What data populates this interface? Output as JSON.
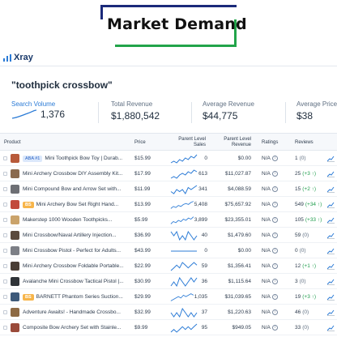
{
  "banner": {
    "title": "Market Demand"
  },
  "app": {
    "name": "Xray"
  },
  "query": "\"toothpick crossbow\"",
  "stats": {
    "search_volume": {
      "label": "Search Volume",
      "value": "1,376"
    },
    "total_revenue": {
      "label": "Total Revenue",
      "value": "$1,880,542"
    },
    "average_revenue": {
      "label": "Average Revenue",
      "value": "$44,775"
    },
    "average_price": {
      "label": "Average Price",
      "value": "$38"
    }
  },
  "table": {
    "columns": {
      "product": "Product",
      "price": "Price",
      "sales_1": "Parent Level",
      "sales_2": "Sales",
      "revenue_1": "Parent Level",
      "revenue_2": "Revenue",
      "ratings": "Ratings",
      "reviews": "Reviews"
    },
    "rows": [
      {
        "badge": "ABA #1",
        "badge_type": "aba",
        "name": "Mini Toothpick Bow Toy | Durab...",
        "price": "$15.99",
        "sales": "0",
        "revenue": "$0.00",
        "ratings": "N/A",
        "reviews": "1",
        "reviews_paren": "(0)",
        "reviews_delta": "",
        "thumb": "#b85a3a",
        "spark": [
          2,
          3,
          2,
          4,
          3,
          5,
          4,
          6,
          5,
          7
        ]
      },
      {
        "badge": "",
        "badge_type": "",
        "name": "Mini Archery Crossbow DIY Assembly Kit...",
        "price": "$17.99",
        "sales": "613",
        "revenue": "$11,027.87",
        "ratings": "N/A",
        "reviews": "25",
        "reviews_paren": "(+3 ↑)",
        "reviews_delta": "",
        "thumb": "#8a6a4e",
        "spark": [
          3,
          4,
          3,
          5,
          6,
          5,
          7,
          6,
          8,
          7
        ]
      },
      {
        "badge": "",
        "badge_type": "",
        "name": "Mini Compound Bow and Arrow Set with...",
        "price": "$11.99",
        "sales": "341",
        "revenue": "$4,088.59",
        "ratings": "N/A",
        "reviews": "15",
        "reviews_paren": "(+2 ↑)",
        "reviews_delta": "",
        "thumb": "#6d6f74",
        "spark": [
          4,
          3,
          5,
          4,
          5,
          3,
          6,
          5,
          6,
          7
        ]
      },
      {
        "badge": "BS",
        "badge_type": "bs",
        "name": "Mini Archery Bow Set Right Hand...",
        "price": "$13.99",
        "sales": "5,408",
        "revenue": "$75,657.92",
        "ratings": "N/A",
        "reviews": "549",
        "reviews_paren": "(+34 ↑)",
        "reviews_delta": "",
        "thumb": "#c24a3c",
        "spark": [
          2,
          4,
          3,
          5,
          4,
          6,
          7,
          6,
          8,
          9
        ]
      },
      {
        "badge": "",
        "badge_type": "",
        "name": "Makerstep 1000 Wooden Toothpicks...",
        "price": "$5.99",
        "sales": "3,899",
        "revenue": "$23,355.01",
        "ratings": "N/A",
        "reviews": "105",
        "reviews_paren": "(+33 ↑)",
        "reviews_delta": "",
        "thumb": "#caa36b",
        "spark": [
          3,
          5,
          4,
          6,
          5,
          7,
          6,
          8,
          7,
          9
        ]
      },
      {
        "badge": "",
        "badge_type": "",
        "name": "Mini Crossbow/Naval Artillery Injection...",
        "price": "$36.99",
        "sales": "40",
        "revenue": "$1,479.60",
        "ratings": "N/A",
        "reviews": "59",
        "reviews_paren": "(0)",
        "reviews_delta": "",
        "thumb": "#5a4a3e",
        "spark": [
          5,
          4,
          5,
          3,
          4,
          3,
          5,
          4,
          3,
          4
        ]
      },
      {
        "badge": "",
        "badge_type": "",
        "name": "Mini Crossbow Pistol - Perfect for Adults...",
        "price": "$43.99",
        "sales": "0",
        "revenue": "$0.00",
        "ratings": "N/A",
        "reviews": "0",
        "reviews_paren": "(0)",
        "reviews_delta": "",
        "thumb": "#7c7f86",
        "spark": [
          4,
          4,
          4,
          4,
          4,
          4,
          4,
          4,
          4,
          4
        ]
      },
      {
        "badge": "",
        "badge_type": "",
        "name": "Mini Archery Crossbow Foldable Portable...",
        "price": "$22.99",
        "sales": "59",
        "revenue": "$1,356.41",
        "ratings": "N/A",
        "reviews": "12",
        "reviews_paren": "(+1 ↑)",
        "reviews_delta": "",
        "thumb": "#4a3e36",
        "spark": [
          3,
          4,
          5,
          4,
          6,
          5,
          4,
          5,
          6,
          5
        ]
      },
      {
        "badge": "",
        "badge_type": "",
        "name": "Avalanche Mini Crossbow Tactical Pistol |...",
        "price": "$30.99",
        "sales": "36",
        "revenue": "$1,115.64",
        "ratings": "N/A",
        "reviews": "3",
        "reviews_paren": "(0)",
        "reviews_delta": "",
        "thumb": "#2f3338",
        "spark": [
          4,
          5,
          4,
          6,
          5,
          4,
          5,
          6,
          5,
          6
        ]
      },
      {
        "badge": "BS",
        "badge_type": "bs",
        "name": "BARNETT Phantom Series Suction...",
        "price": "$29.99",
        "sales": "1,035",
        "revenue": "$31,039.65",
        "ratings": "N/A",
        "reviews": "19",
        "reviews_paren": "(+3 ↑)",
        "reviews_delta": "",
        "thumb": "#3e5a7a",
        "spark": [
          3,
          4,
          5,
          6,
          5,
          7,
          6,
          7,
          8,
          7
        ]
      },
      {
        "badge": "",
        "badge_type": "",
        "name": "Adventure Awaits! - Handmade Crossbo...",
        "price": "$32.99",
        "sales": "37",
        "revenue": "$1,220.63",
        "ratings": "N/A",
        "reviews": "46",
        "reviews_paren": "(0)",
        "reviews_delta": "",
        "thumb": "#8d6a44",
        "spark": [
          5,
          4,
          5,
          4,
          6,
          5,
          4,
          5,
          4,
          5
        ]
      },
      {
        "badge": "",
        "badge_type": "",
        "name": "Composite Bow Archery Set with Stainle...",
        "price": "$9.99",
        "sales": "95",
        "revenue": "$949.05",
        "ratings": "N/A",
        "reviews": "33",
        "reviews_paren": "(0)",
        "reviews_delta": "",
        "thumb": "#9a4a3a",
        "spark": [
          4,
          5,
          4,
          5,
          6,
          5,
          6,
          5,
          6,
          7
        ]
      }
    ]
  },
  "colors": {
    "accent": "#2b7bd6",
    "positive": "#1f9d4c",
    "banner_blue": "#1b2a7a",
    "banner_green": "#22a44a",
    "best_seller": "#f7b54a"
  },
  "icons": {
    "logo": "xray-logo-icon",
    "info": "info-icon",
    "trend": "trend-chart-icon",
    "sparkline": "sparkline"
  }
}
